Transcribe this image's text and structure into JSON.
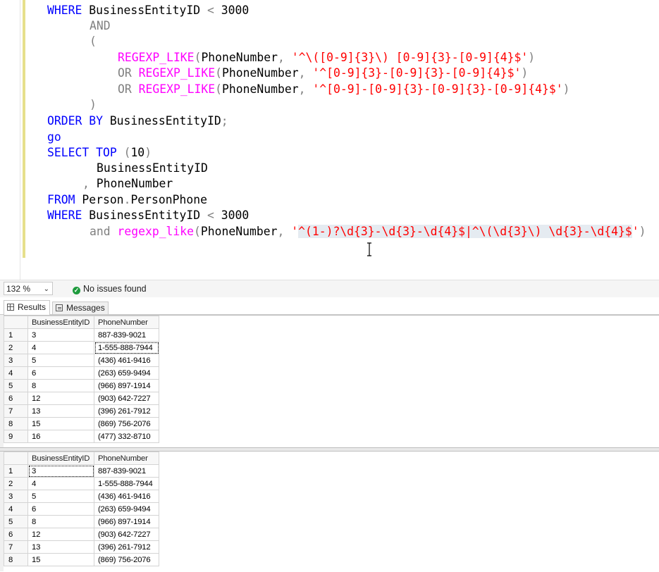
{
  "editor": {
    "lines": [
      [
        {
          "t": "WHERE ",
          "c": "kw"
        },
        {
          "t": "BusinessEntityID ",
          "c": ""
        },
        {
          "t": "<",
          "c": "gr"
        },
        {
          "t": " 3000",
          "c": ""
        }
      ],
      [
        {
          "t": "AND",
          "c": "gr"
        }
      ],
      [
        {
          "t": "(",
          "c": "gr"
        }
      ],
      [
        {
          "t": "REGEXP_LIKE",
          "c": "fn"
        },
        {
          "t": "(",
          "c": "gr"
        },
        {
          "t": "PhoneNumber",
          "c": ""
        },
        {
          "t": ", ",
          "c": "gr"
        },
        {
          "t": "'^\\([0-9]{3}\\) [0-9]{3}-[0-9]{4}$'",
          "c": "str"
        },
        {
          "t": ")",
          "c": "gr"
        }
      ],
      [
        {
          "t": "OR ",
          "c": "gr"
        },
        {
          "t": "REGEXP_LIKE",
          "c": "fn"
        },
        {
          "t": "(",
          "c": "gr"
        },
        {
          "t": "PhoneNumber",
          "c": ""
        },
        {
          "t": ", ",
          "c": "gr"
        },
        {
          "t": "'^[0-9]{3}-[0-9]{3}-[0-9]{4}$'",
          "c": "str"
        },
        {
          "t": ")",
          "c": "gr"
        }
      ],
      [
        {
          "t": "OR ",
          "c": "gr"
        },
        {
          "t": "REGEXP_LIKE",
          "c": "fn"
        },
        {
          "t": "(",
          "c": "gr"
        },
        {
          "t": "PhoneNumber",
          "c": ""
        },
        {
          "t": ", ",
          "c": "gr"
        },
        {
          "t": "'^[0-9]-[0-9]{3}-[0-9]{3}-[0-9]{4}$'",
          "c": "str"
        },
        {
          "t": ")",
          "c": "gr"
        }
      ],
      [
        {
          "t": ")",
          "c": "gr"
        }
      ],
      [
        {
          "t": "ORDER BY ",
          "c": "kw"
        },
        {
          "t": "BusinessEntityID",
          "c": ""
        },
        {
          "t": ";",
          "c": "gr"
        }
      ],
      [
        {
          "t": "go",
          "c": "kw"
        }
      ],
      [
        {
          "t": "SELECT ",
          "c": "kw"
        },
        {
          "t": "TOP ",
          "c": "kw"
        },
        {
          "t": "(",
          "c": "gr"
        },
        {
          "t": "10",
          "c": ""
        },
        {
          "t": ")",
          "c": "gr"
        }
      ],
      [
        {
          "t": "BusinessEntityID",
          "c": ""
        }
      ],
      [
        {
          "t": ", ",
          "c": "gr"
        },
        {
          "t": "PhoneNumber",
          "c": ""
        }
      ],
      [
        {
          "t": "FROM ",
          "c": "kw"
        },
        {
          "t": "Person",
          "c": ""
        },
        {
          "t": ".",
          "c": "gr"
        },
        {
          "t": "PersonPhone",
          "c": ""
        }
      ],
      [
        {
          "t": "WHERE ",
          "c": "kw"
        },
        {
          "t": "BusinessEntityID ",
          "c": ""
        },
        {
          "t": "<",
          "c": "gr"
        },
        {
          "t": " 3000",
          "c": ""
        }
      ],
      [
        {
          "t": "and ",
          "c": "gr"
        },
        {
          "t": "regexp_like",
          "c": "fn"
        },
        {
          "t": "(",
          "c": "gr"
        },
        {
          "t": "PhoneNumber",
          "c": ""
        },
        {
          "t": ", ",
          "c": "gr"
        },
        {
          "t": "'",
          "c": "str"
        },
        {
          "t": "^(1-)?\\d{3}-\\d{3}-\\d{4}$|^\\(\\d{3}\\) \\d{3}-\\d{4}$",
          "c": "str sel"
        },
        {
          "t": "'",
          "c": "str"
        },
        {
          "t": ")",
          "c": "gr"
        }
      ]
    ]
  },
  "status": {
    "zoom": "132 %",
    "issues": "No issues found"
  },
  "tabs": {
    "results": "Results",
    "messages": "Messages"
  },
  "grid": {
    "columns": [
      "BusinessEntityID",
      "PhoneNumber"
    ],
    "result1": [
      [
        "1",
        "3",
        "887-839-9021"
      ],
      [
        "2",
        "4",
        "1-555-888-7944"
      ],
      [
        "3",
        "5",
        "(436) 461-9416"
      ],
      [
        "4",
        "6",
        "(263) 659-9494"
      ],
      [
        "5",
        "8",
        "(966) 897-1914"
      ],
      [
        "6",
        "12",
        "(903) 642-7227"
      ],
      [
        "7",
        "13",
        "(396) 261-7912"
      ],
      [
        "8",
        "15",
        "(869) 756-2076"
      ],
      [
        "9",
        "16",
        "(477) 332-8710"
      ]
    ],
    "result2": [
      [
        "1",
        "3",
        "887-839-9021"
      ],
      [
        "2",
        "4",
        "1-555-888-7944"
      ],
      [
        "3",
        "5",
        "(436) 461-9416"
      ],
      [
        "4",
        "6",
        "(263) 659-9494"
      ],
      [
        "5",
        "8",
        "(966) 897-1914"
      ],
      [
        "6",
        "12",
        "(903) 642-7227"
      ],
      [
        "7",
        "13",
        "(396) 261-7912"
      ],
      [
        "8",
        "15",
        "(869) 756-2076"
      ]
    ]
  }
}
